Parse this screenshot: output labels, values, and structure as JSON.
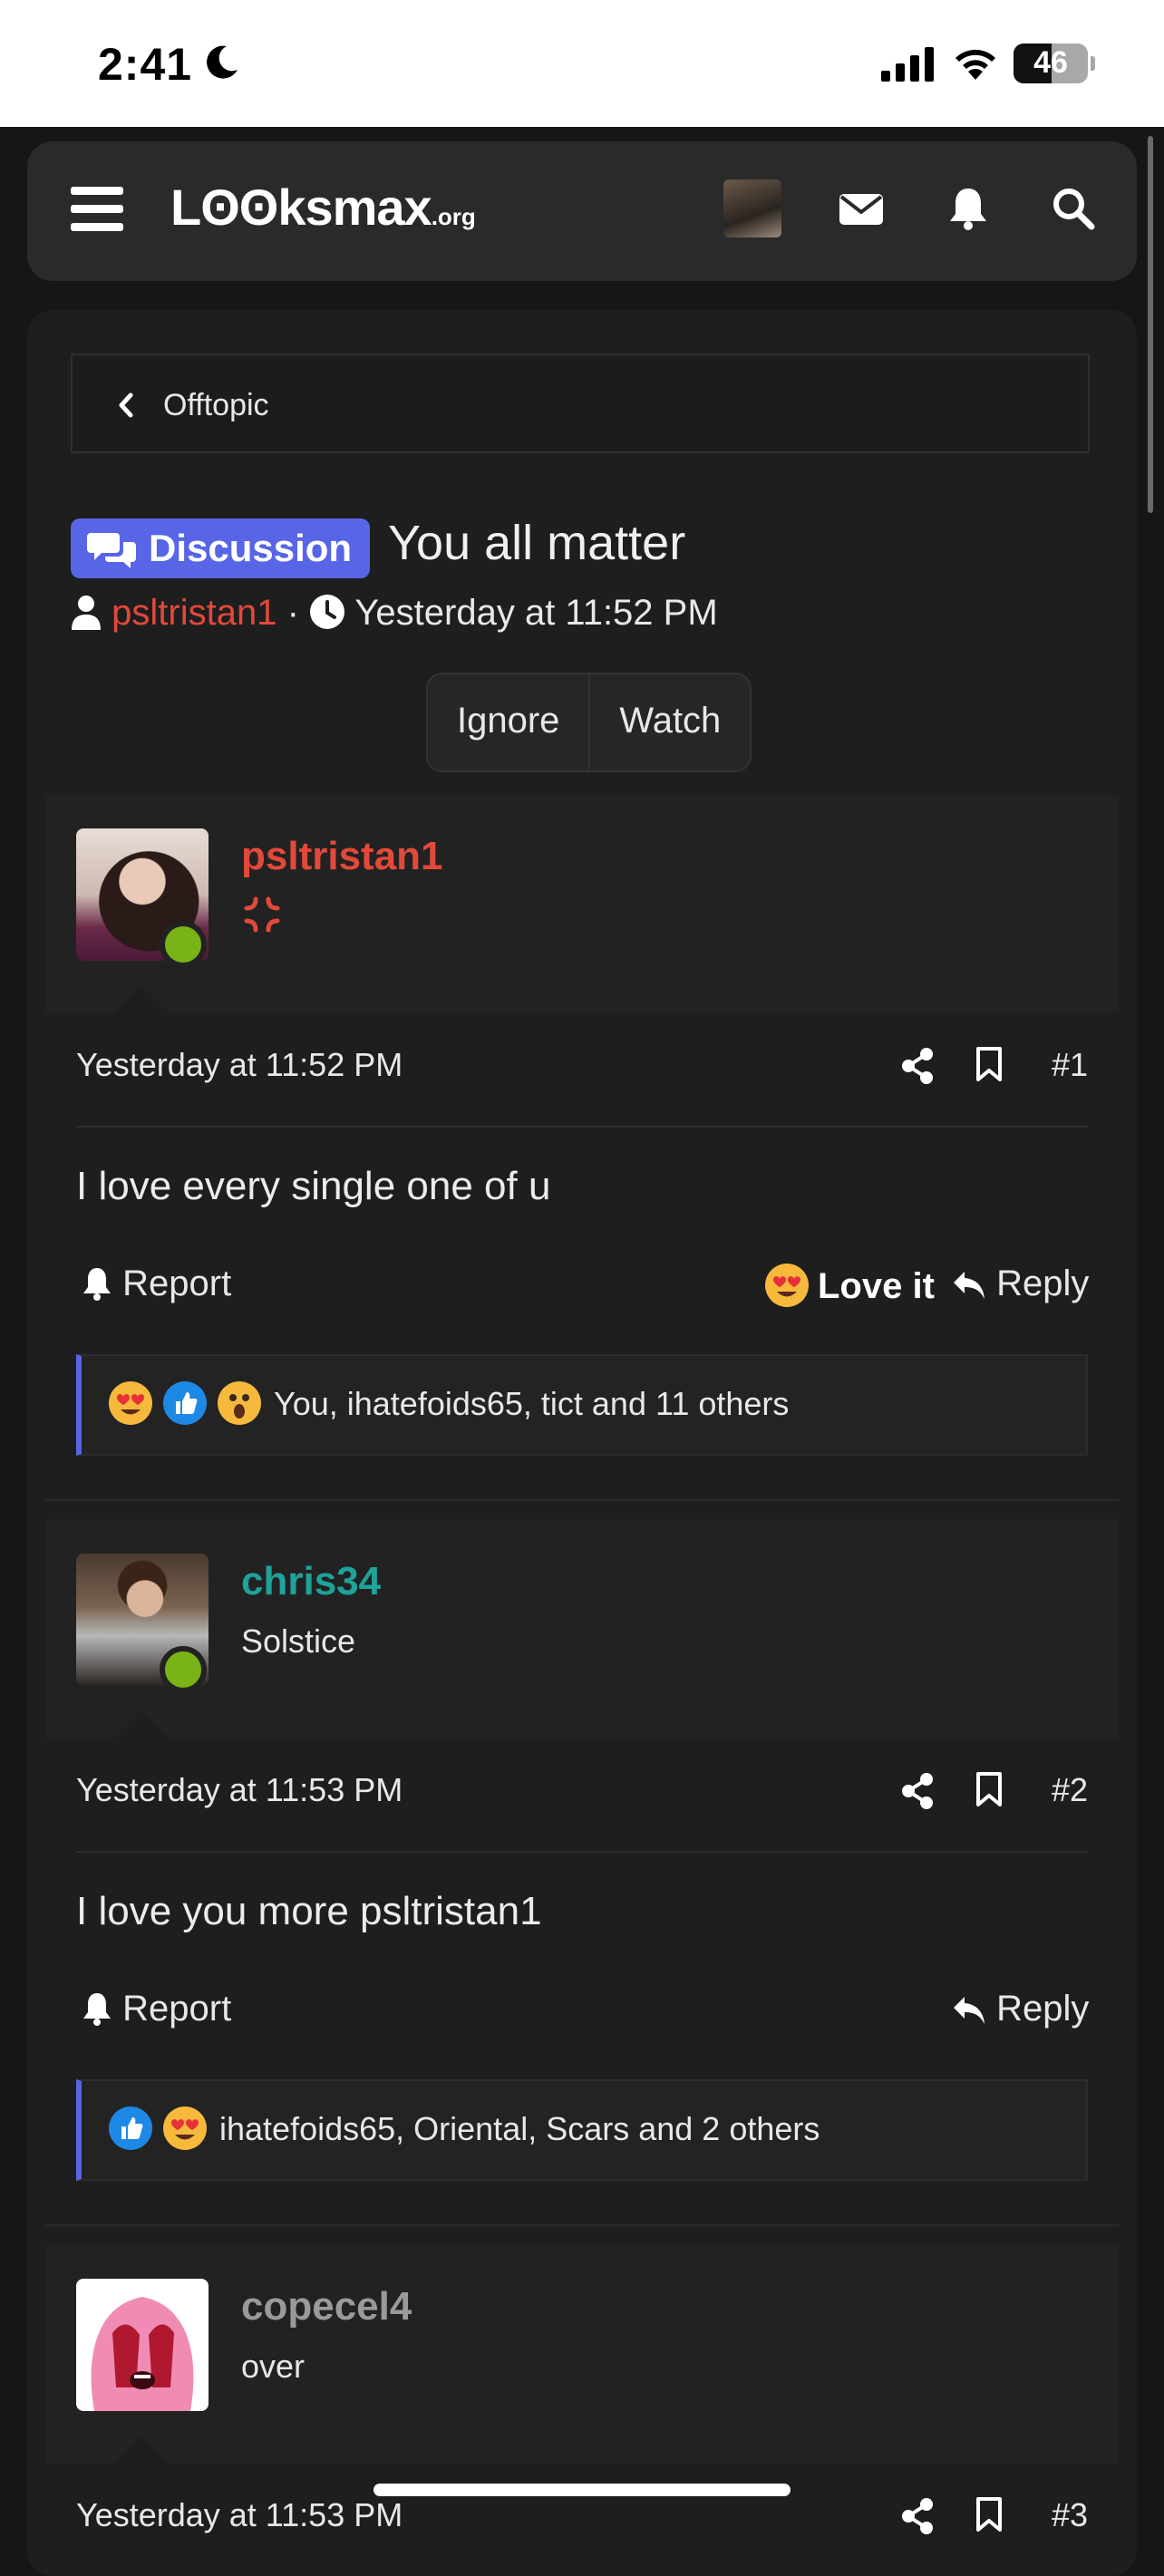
{
  "status_bar": {
    "time": "2:41",
    "battery": "46"
  },
  "nav": {
    "logo_main": "Lʘʘksmax",
    "logo_suffix": ".org"
  },
  "breadcrumb": {
    "label": "Offtopic"
  },
  "thread": {
    "tag": "Discussion",
    "title": "You all matter",
    "author": "psltristan1",
    "separator": "·",
    "time": "Yesterday at 11:52 PM",
    "buttons": {
      "ignore": "Ignore",
      "watch": "Watch"
    }
  },
  "posts": [
    {
      "username": "psltristan1",
      "username_color": "#e2493a",
      "user_title": "",
      "time": "Yesterday at 11:52 PM",
      "number": "#1",
      "body": "I love every single one of u",
      "report": "Report",
      "love_it": "Love it",
      "reply": "Reply",
      "reactions_text": "You, ihatefoids65, tict and 11 others"
    },
    {
      "username": "chris34",
      "username_color": "#1ea39a",
      "user_title": "Solstice",
      "time": "Yesterday at 11:53 PM",
      "number": "#2",
      "body": "I love you more psltristan1",
      "report": "Report",
      "reply": "Reply",
      "reactions_text": "ihatefoids65, Oriental, Scars and 2 others"
    },
    {
      "username": "copecel4",
      "username_color": "#9a9a9a",
      "user_title": "over",
      "time": "Yesterday at 11:53 PM",
      "number": "#3"
    }
  ]
}
